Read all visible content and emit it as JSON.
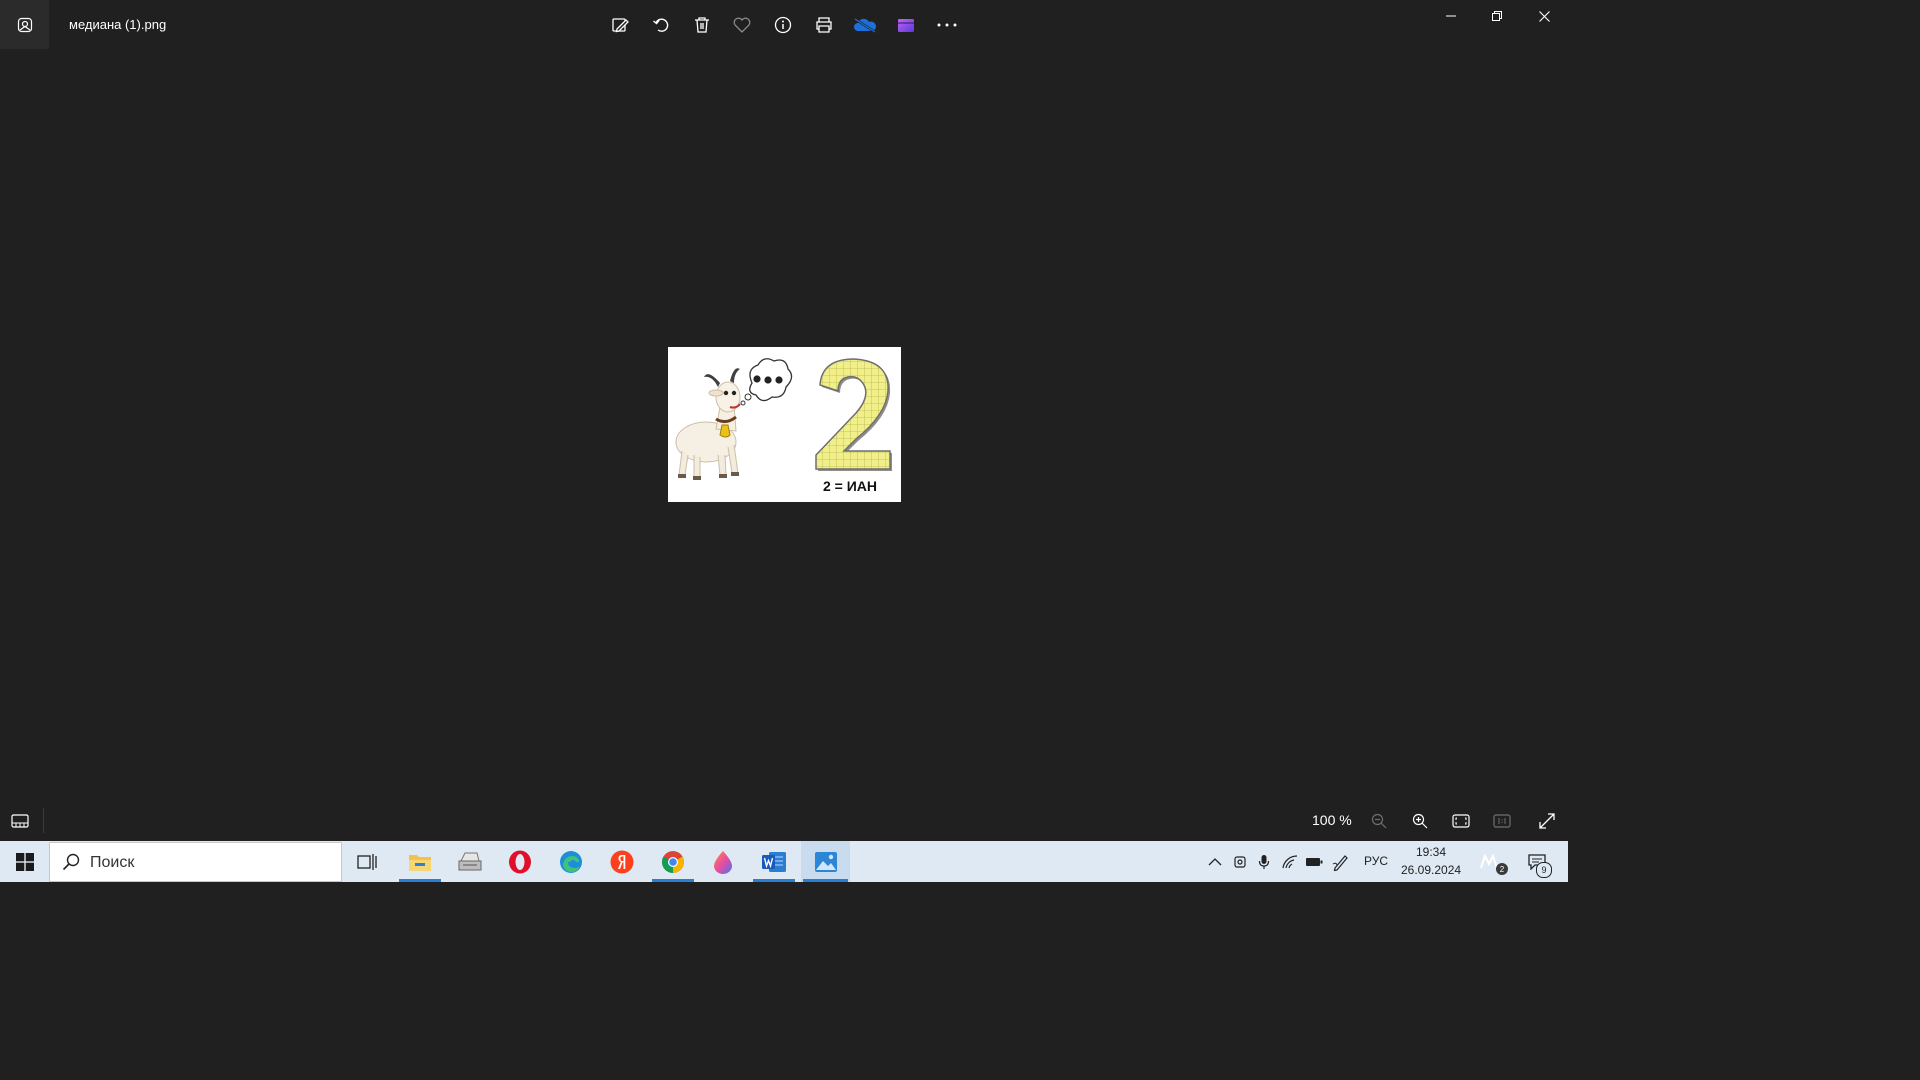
{
  "titlebar": {
    "filename": "медиана (1).png"
  },
  "toolbar": {
    "tools": [
      "edit-image-icon",
      "rotate-icon",
      "delete-icon",
      "favorite-icon",
      "info-icon",
      "print-icon",
      "onedrive-icon",
      "clipchamp-icon",
      "more-icon"
    ]
  },
  "photo": {
    "caption": "2 = ИАН"
  },
  "bottombar": {
    "zoom": "100 %"
  },
  "taskbar": {
    "search_placeholder": "Поиск",
    "language": "РУС",
    "time": "19:34",
    "date": "26.09.2024",
    "notification_count": "9",
    "meet_badge": "2"
  },
  "colors": {
    "background": "#202020",
    "taskbar": "#dfe9f3",
    "accent": "#2a7fd4"
  }
}
